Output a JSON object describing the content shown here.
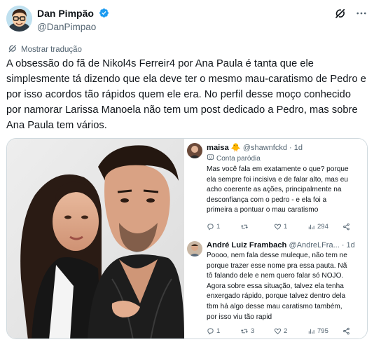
{
  "tweet": {
    "display_name": "Dan Pimpão",
    "handle": "@DanPimpao",
    "translation_label": "Mostrar tradução",
    "text": "A obsessão do fã de Nikol4s Ferreir4 por Ana Paula é tanta que ele simplesmente tá dizendo que ela deve ter o mesmo mau-caratismo de Pedro e por isso acordos tão rápidos quem ele era. No perfil desse moço conhecido por namorar Larissa Manoela não tem um post dedicado a Pedro, mas sobre Ana Paula tem vários."
  },
  "icons": {
    "verified": "verified-badge-icon",
    "grok": "grok-icon",
    "more": "more-icon",
    "translate": "translate-icon",
    "reply": "reply-icon",
    "retweet": "retweet-icon",
    "like": "like-icon",
    "views": "views-icon",
    "share": "share-icon"
  },
  "colors": {
    "verified": "#1d9bf0",
    "secondary_text": "#536471",
    "border": "#cfd9de"
  },
  "screenshot_replies": [
    {
      "name": "maisa 🐥",
      "handle": "@shawnfckd · 1d",
      "badge": "Conta paródia",
      "lines": [
        "Mas você fala em exatamente o que? porque",
        "ela sempre foi incisiva e de falar alto, mas eu",
        "acho coerente as ações, principalmente na",
        "desconfiança com o pedro - e ela foi a",
        "primeira a pontuar o mau caratismo"
      ],
      "replies": "1",
      "retweets": "",
      "likes": "1",
      "views": "294"
    },
    {
      "name": "André Luiz Frambach",
      "handle": "@AndreLFra... · 1d",
      "badge": "",
      "lines": [
        "Poooo, nem fala desse muleque, não tem ne",
        "porque trazer esse nome pra essa pauta. Nã",
        "tô falando dele e nem quero falar só NOJO.",
        "Agora sobre essa situação, talvez ela tenha",
        "enxergado rápido, porque talvez dentro dela",
        "tbm há algo desse mau caratismo também,",
        "por isso viu tão rapid"
      ],
      "replies": "1",
      "retweets": "3",
      "likes": "2",
      "views": "795"
    }
  ]
}
